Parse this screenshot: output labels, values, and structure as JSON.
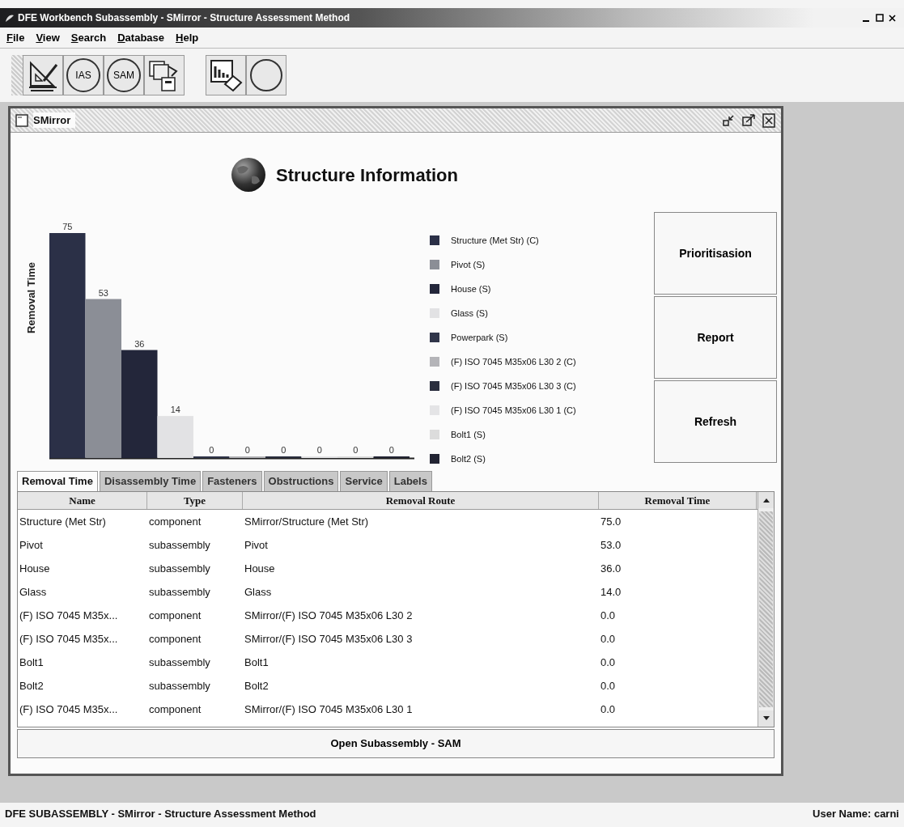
{
  "window": {
    "title": "DFE Workbench Subassembly - SMirror - Structure Assessment Method"
  },
  "menu": [
    "File",
    "View",
    "Search",
    "Database",
    "Help"
  ],
  "toolbar": [
    {
      "kind": "drawing"
    },
    {
      "kind": "circle",
      "label": "IAS"
    },
    {
      "kind": "circle",
      "label": "SAM"
    },
    {
      "kind": "documents"
    },
    {
      "kind": "chart"
    },
    {
      "kind": "circle"
    }
  ],
  "frame": {
    "title": "SMirror",
    "heading": "Structure Information",
    "chart_data": {
      "type": "bar",
      "ylabel": "Removal Time",
      "data_labels": true,
      "series": [
        {
          "name": "Structure (Met Str) (C)",
          "color": "#2b3047",
          "values": [
            75
          ]
        },
        {
          "name": "Pivot (S)",
          "color": "#8b8e96",
          "values": [
            53
          ]
        },
        {
          "name": "House (S)",
          "color": "#23263a",
          "values": [
            36
          ]
        },
        {
          "name": "Glass (S)",
          "color": "#e2e2e4",
          "values": [
            14
          ]
        },
        {
          "name": "Powerpark (S)",
          "color": "#30354a",
          "values": [
            0
          ]
        },
        {
          "name": "(F) ISO 7045 M35x06 L30 2 (C)",
          "color": "#b4b4b8",
          "values": [
            0
          ]
        },
        {
          "name": "(F) ISO 7045 M35x06 L30 3 (C)",
          "color": "#2a2e3e",
          "values": [
            0
          ]
        },
        {
          "name": "(F) ISO 7045 M35x06 L30 1 (C)",
          "color": "#e4e4e6",
          "values": [
            0
          ]
        },
        {
          "name": "Bolt1 (S)",
          "color": "#dcdcdc",
          "values": [
            0
          ]
        },
        {
          "name": "Bolt2 (S)",
          "color": "#222433",
          "values": [
            0
          ]
        }
      ]
    },
    "buttons": [
      "Prioritisasion",
      "Report",
      "Refresh"
    ],
    "tabs": [
      {
        "label": "Removal Time",
        "selected": true
      },
      {
        "label": "Disassembly Time",
        "selected": false
      },
      {
        "label": "Fasteners",
        "selected": false
      },
      {
        "label": "Obstructions",
        "selected": false
      },
      {
        "label": "Service",
        "selected": false
      },
      {
        "label": "Labels",
        "selected": false
      }
    ],
    "table": {
      "columns": [
        "Name",
        "Type",
        "Removal Route",
        "Removal Time"
      ],
      "rows": [
        [
          "Structure (Met Str)",
          "component",
          "SMirror/Structure (Met Str)",
          "75.0"
        ],
        [
          "Pivot",
          "subassembly",
          "Pivot",
          "53.0"
        ],
        [
          "House",
          "subassembly",
          "House",
          "36.0"
        ],
        [
          "Glass",
          "subassembly",
          "Glass",
          "14.0"
        ],
        [
          "(F) ISO 7045 M35x...",
          "component",
          "SMirror/(F) ISO 7045 M35x06 L30 2",
          "0.0"
        ],
        [
          "(F) ISO 7045 M35x...",
          "component",
          "SMirror/(F) ISO 7045 M35x06 L30 3",
          "0.0"
        ],
        [
          "Bolt1",
          "subassembly",
          "Bolt1",
          "0.0"
        ],
        [
          "Bolt2",
          "subassembly",
          "Bolt2",
          "0.0"
        ],
        [
          "(F) ISO 7045 M35x...",
          "component",
          "SMirror/(F) ISO 7045 M35x06 L30 1",
          "0.0"
        ]
      ]
    },
    "action_button": "Open Subassembly - SAM"
  },
  "status_bar": {
    "left": "DFE SUBASSEMBLY - SMirror - Structure Assessment Method",
    "right": "User Name: carni"
  }
}
